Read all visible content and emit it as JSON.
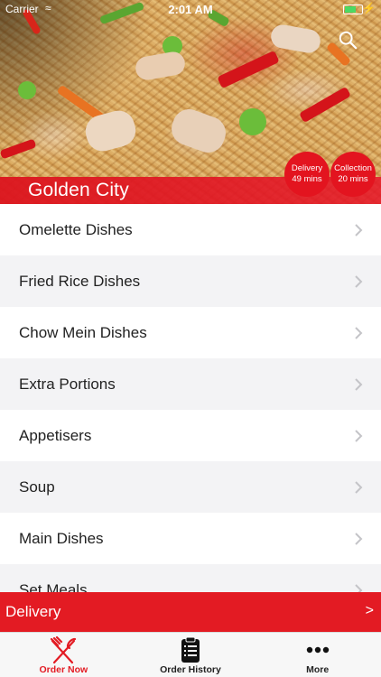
{
  "status_bar": {
    "carrier": "Carrier",
    "time": "2:01 AM"
  },
  "hero": {
    "restaurant_name": "Golden City",
    "delivery_badge": {
      "label": "Delivery",
      "time": "49 mins"
    },
    "collection_badge": {
      "label": "Collection",
      "time": "20 mins"
    }
  },
  "menu": {
    "items": [
      {
        "label": "Omelette Dishes"
      },
      {
        "label": "Fried Rice Dishes"
      },
      {
        "label": "Chow Mein Dishes"
      },
      {
        "label": "Extra Portions"
      },
      {
        "label": "Appetisers"
      },
      {
        "label": "Soup"
      },
      {
        "label": "Main Dishes"
      },
      {
        "label": "Set Meals"
      }
    ]
  },
  "order_bar": {
    "label": "Delivery",
    "arrow": ">"
  },
  "tabs": [
    {
      "label": "Order Now",
      "icon": "fork-knife-icon",
      "active": true
    },
    {
      "label": "Order History",
      "icon": "clipboard-icon",
      "active": false
    },
    {
      "label": "More",
      "icon": "more-dots-icon",
      "active": false
    }
  ],
  "colors": {
    "accent": "#e31b23",
    "row_alt": "#f3f3f5"
  }
}
